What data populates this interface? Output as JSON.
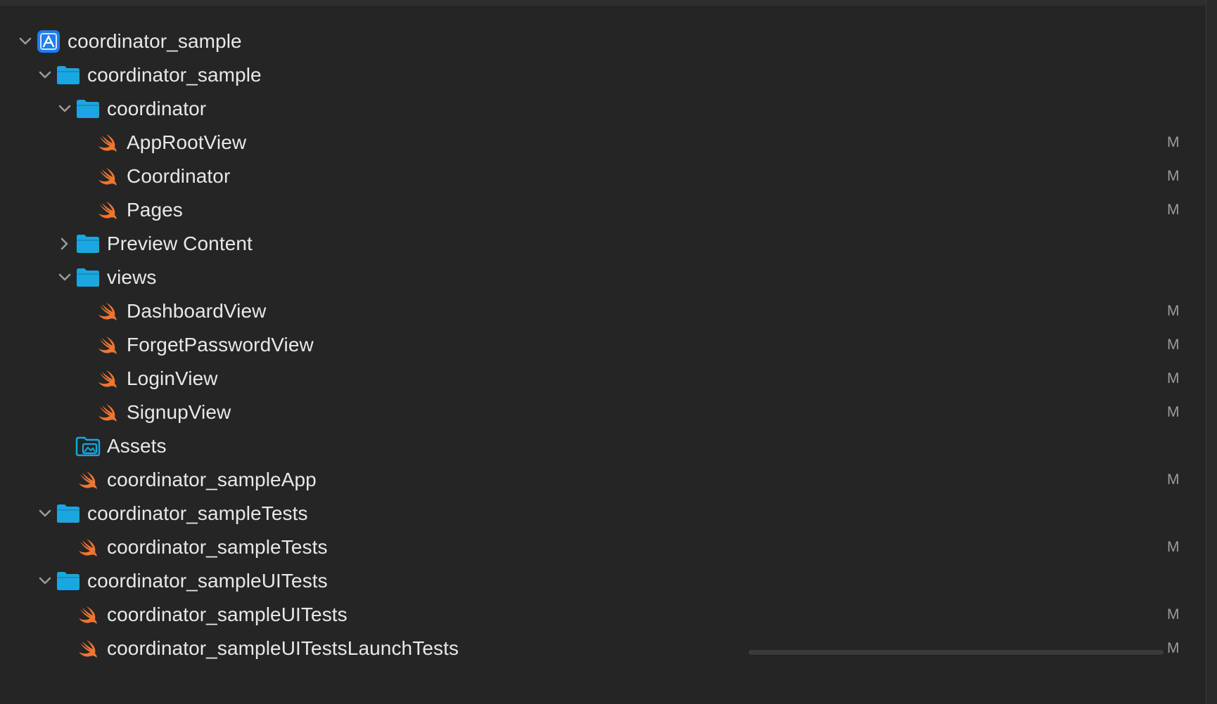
{
  "colors": {
    "background": "#252526",
    "text": "#e8e8e8",
    "badge": "#9b9b9f",
    "folder": "#1ba6e0",
    "swift": "#f0752e",
    "project": "#1c7ef1"
  },
  "tree": [
    {
      "name": "coordinator_sample",
      "type": "project",
      "icon": "xcode-project-icon",
      "expanded": true,
      "status": ""
    },
    {
      "name": "coordinator_sample",
      "type": "folder",
      "icon": "folder-icon",
      "expanded": true,
      "status": ""
    },
    {
      "name": "coordinator",
      "type": "folder",
      "icon": "folder-icon",
      "expanded": true,
      "status": ""
    },
    {
      "name": "AppRootView",
      "type": "swift",
      "icon": "swift-file-icon",
      "status": "M"
    },
    {
      "name": "Coordinator",
      "type": "swift",
      "icon": "swift-file-icon",
      "status": "M"
    },
    {
      "name": "Pages",
      "type": "swift",
      "icon": "swift-file-icon",
      "status": "M"
    },
    {
      "name": "Preview Content",
      "type": "folder",
      "icon": "folder-icon",
      "expanded": false,
      "status": ""
    },
    {
      "name": "views",
      "type": "folder",
      "icon": "folder-icon",
      "expanded": true,
      "status": ""
    },
    {
      "name": "DashboardView",
      "type": "swift",
      "icon": "swift-file-icon",
      "status": "M"
    },
    {
      "name": "ForgetPasswordView",
      "type": "swift",
      "icon": "swift-file-icon",
      "status": "M"
    },
    {
      "name": "LoginView",
      "type": "swift",
      "icon": "swift-file-icon",
      "status": "M"
    },
    {
      "name": "SignupView",
      "type": "swift",
      "icon": "swift-file-icon",
      "status": "M"
    },
    {
      "name": "Assets",
      "type": "assets",
      "icon": "asset-catalog-icon",
      "status": ""
    },
    {
      "name": "coordinator_sampleApp",
      "type": "swift",
      "icon": "swift-file-icon",
      "status": "M"
    },
    {
      "name": "coordinator_sampleTests",
      "type": "folder",
      "icon": "folder-icon",
      "expanded": true,
      "status": ""
    },
    {
      "name": "coordinator_sampleTests",
      "type": "swift",
      "icon": "swift-file-icon",
      "status": "M"
    },
    {
      "name": "coordinator_sampleUITests",
      "type": "folder",
      "icon": "folder-icon",
      "expanded": true,
      "status": ""
    },
    {
      "name": "coordinator_sampleUITests",
      "type": "swift",
      "icon": "swift-file-icon",
      "status": "M"
    },
    {
      "name": "coordinator_sampleUITestsLaunchTests",
      "type": "swift",
      "icon": "swift-file-icon",
      "status": "M"
    }
  ]
}
